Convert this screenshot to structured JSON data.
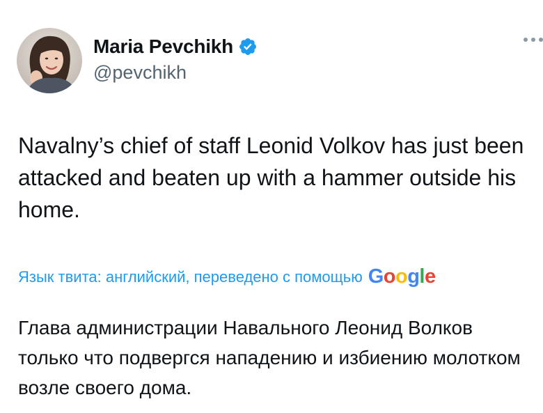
{
  "author": {
    "display_name": "Maria Pevchikh",
    "handle": "@pevchikh",
    "verified": true,
    "avatar": "profile-photo"
  },
  "tweet": {
    "text": "Navalny’s chief of staff Leonid Volkov has just been attacked and beaten up with a hammer outside his home."
  },
  "translation": {
    "label": "Язык твита: английский, переведено с помощью",
    "provider_letters": [
      "G",
      "o",
      "o",
      "g",
      "l",
      "e"
    ],
    "translated_text": "Глава администрации Навального Леонид Волков только что подвергся нападению и избиению молотком возле своего дома."
  },
  "icons": {
    "verified": "verified-badge-icon",
    "more": "more-options-icon"
  },
  "colors": {
    "link": "#1d9bf0",
    "secondary_text": "#536471",
    "primary_text": "#0f1419",
    "verified": "#1d9bf0"
  }
}
